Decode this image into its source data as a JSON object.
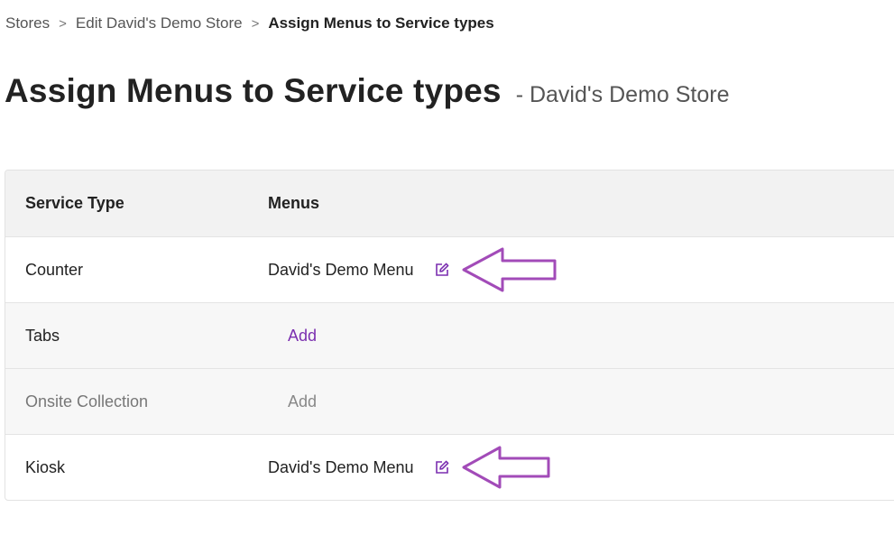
{
  "breadcrumb": {
    "items": [
      "Stores",
      "Edit David's Demo Store"
    ],
    "separator": ">",
    "current": "Assign Menus to Service types"
  },
  "page": {
    "title": "Assign Menus to Service types",
    "subtitle": "- David's Demo Store"
  },
  "table": {
    "headers": {
      "service_type": "Service Type",
      "menus": "Menus"
    },
    "rows": [
      {
        "service_type": "Counter",
        "menu": "David's Demo Menu",
        "enabled": true,
        "has_menu": true
      },
      {
        "service_type": "Tabs",
        "add_label": "Add",
        "enabled": true,
        "has_menu": false
      },
      {
        "service_type": "Onsite Collection",
        "add_label": "Add",
        "enabled": false,
        "has_menu": false
      },
      {
        "service_type": "Kiosk",
        "menu": "David's Demo Menu",
        "enabled": true,
        "has_menu": true
      }
    ]
  },
  "icons": {
    "edit": "edit-pencil-icon",
    "annotation": "left-arrow-outline"
  },
  "colors": {
    "accent": "#7b2fb0",
    "annotation_arrow": "#a24bb8",
    "header_bg": "#f2f2f2"
  }
}
